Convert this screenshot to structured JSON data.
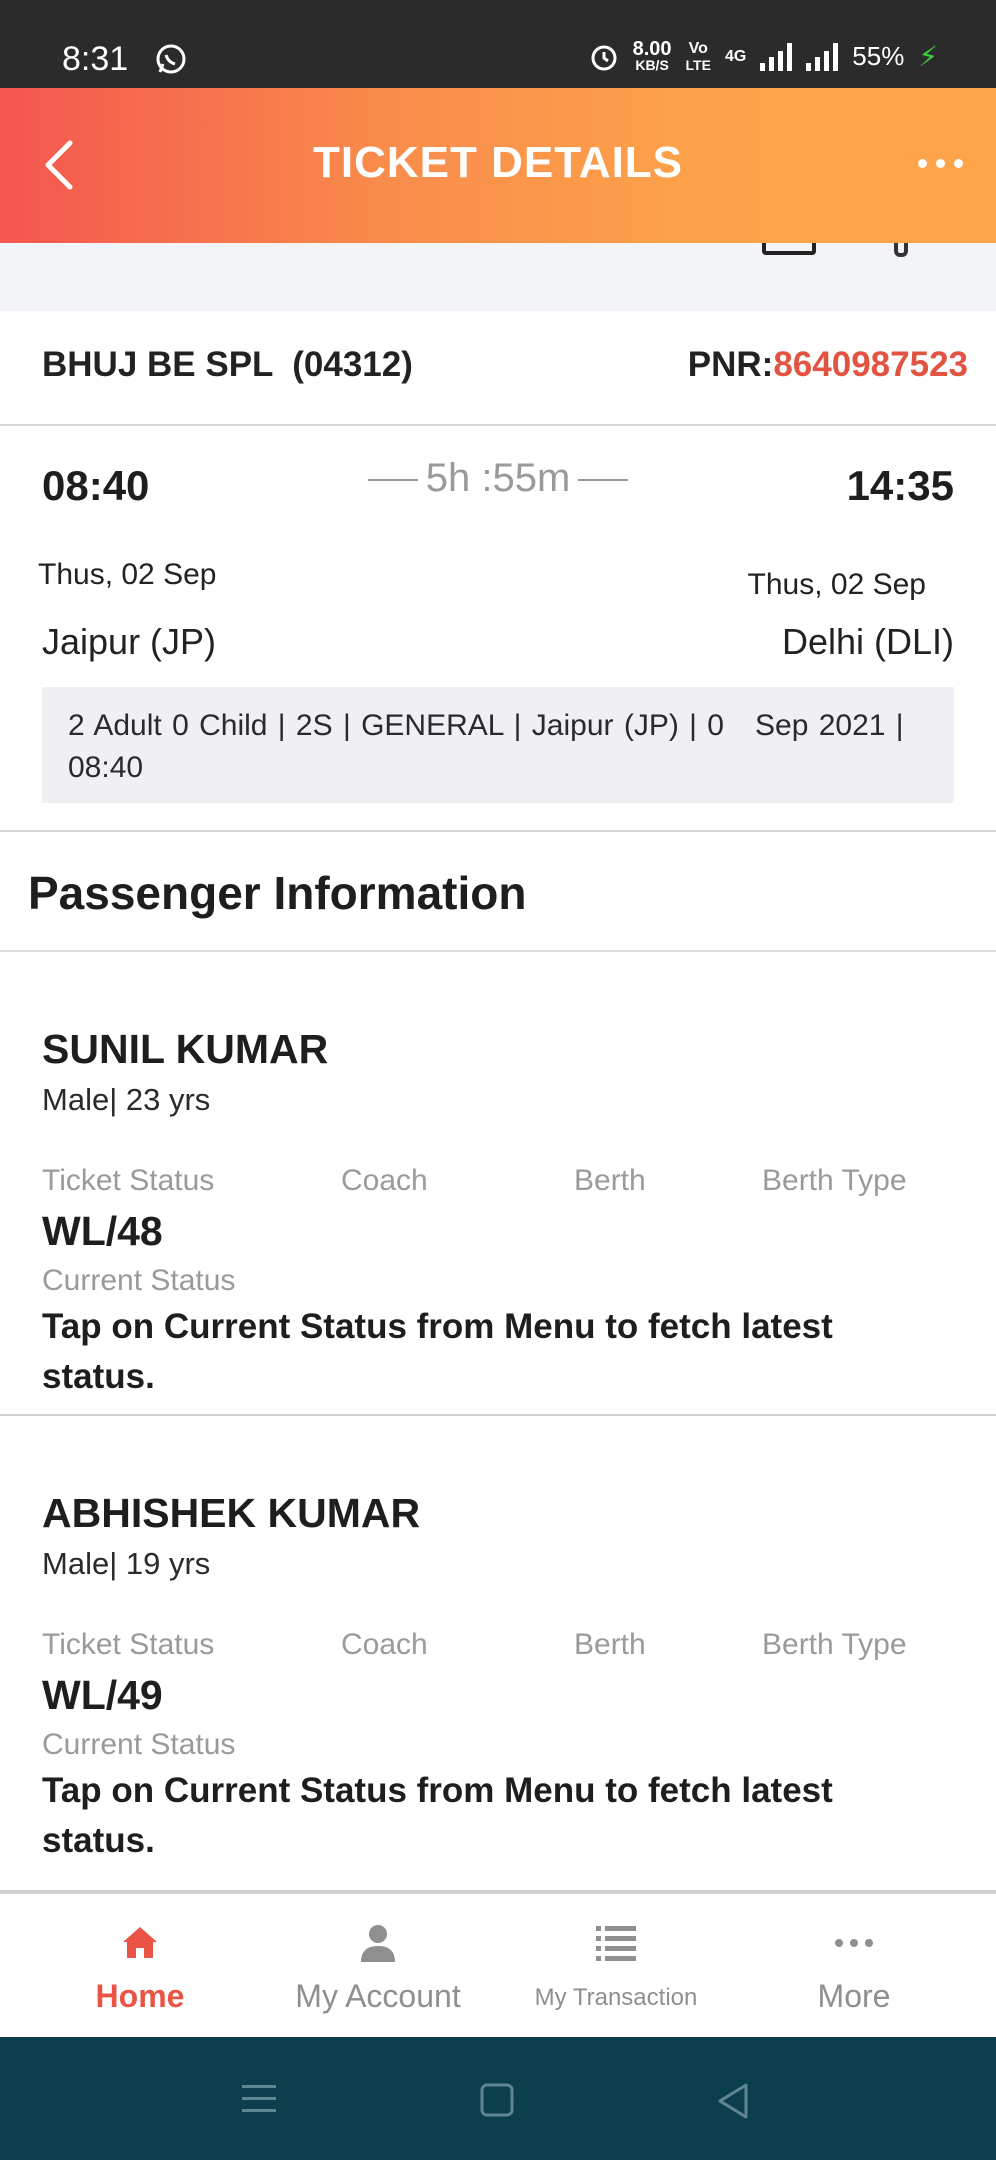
{
  "status_bar": {
    "time": "8:31",
    "speed_top": "8.00",
    "speed_bottom": "KB/S",
    "volte_top": "Vo",
    "volte_bottom": "LTE",
    "network": "4G",
    "battery": "55%"
  },
  "header": {
    "title": "TICKET DETAILS"
  },
  "train": {
    "name": "BHUJ BE SPL  (04312)",
    "pnr_label": "PNR:",
    "pnr": "8640987523"
  },
  "journey": {
    "departure_time": "08:40",
    "arrival_time": "14:35",
    "duration": "5h :55m",
    "departure_date": "Thus, 02 Sep",
    "arrival_date": "Thus, 02 Sep",
    "from": "Jaipur (JP)",
    "to": "Delhi (DLI)",
    "summary": "2 Adult 0 Child | 2S | GENERAL | Jaipur (JP) | 0   Sep 2021 | 08:40"
  },
  "passenger_section": {
    "title": "Passenger Information",
    "labels": {
      "ticket_status": "Ticket Status",
      "coach": "Coach",
      "berth": "Berth",
      "berth_type": "Berth Type",
      "current_status": "Current Status"
    },
    "passengers": [
      {
        "name": "SUNIL KUMAR",
        "info": "Male| 23 yrs",
        "ticket_status": "WL/48",
        "current_status_msg": "Tap on Current Status from Menu to fetch latest status."
      },
      {
        "name": "ABHISHEK KUMAR",
        "info": "Male| 19 yrs",
        "ticket_status": "WL/49",
        "current_status_msg": "Tap on Current Status from Menu to fetch latest status."
      }
    ]
  },
  "bottom_nav": [
    {
      "label": "Home",
      "icon": "home-icon",
      "active": true
    },
    {
      "label": "My Account",
      "icon": "user-icon",
      "active": false
    },
    {
      "label": "My Transaction",
      "icon": "list-icon",
      "active": false
    },
    {
      "label": "More",
      "icon": "more-dots-icon",
      "active": false
    }
  ],
  "colors": {
    "accent": "#ea5446",
    "header_gradient_start": "#f45650",
    "header_gradient_end": "#fda54a",
    "system_nav": "#0b3f4d"
  }
}
